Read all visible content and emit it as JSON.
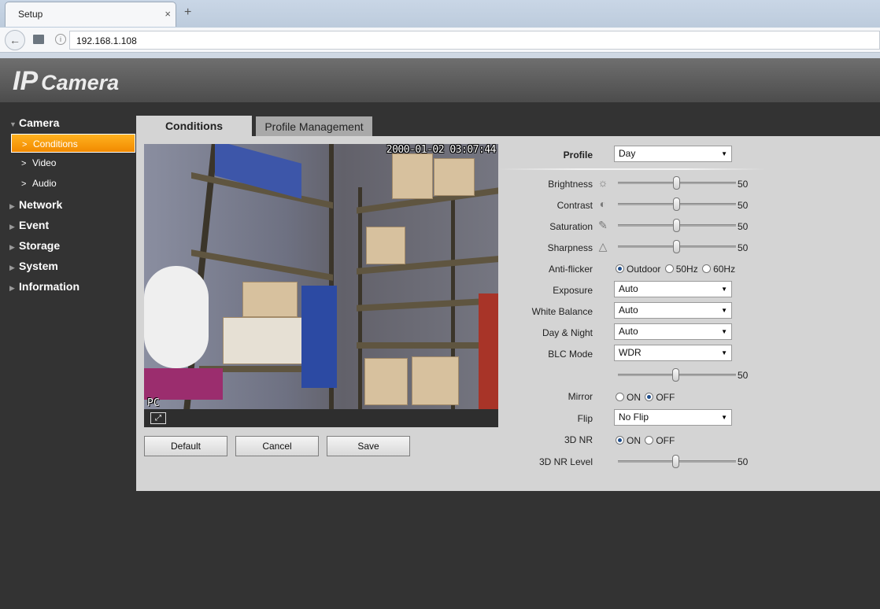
{
  "browser": {
    "tab_title": "Setup",
    "tab_close": "×",
    "new_tab": "+",
    "back": "←",
    "info": "i",
    "address": "192.168.1.108"
  },
  "header": {
    "logo_ip": "IP",
    "logo_camera": "Camera"
  },
  "nav": {
    "items": [
      {
        "label": "Camera",
        "expanded": true,
        "subitems": [
          {
            "label": "Conditions",
            "active": true
          },
          {
            "label": "Video",
            "active": false
          },
          {
            "label": "Audio",
            "active": false
          }
        ]
      },
      {
        "label": "Network"
      },
      {
        "label": "Event"
      },
      {
        "label": "Storage"
      },
      {
        "label": "System"
      },
      {
        "label": "Information"
      }
    ]
  },
  "tabs": [
    {
      "label": "Conditions",
      "active": true
    },
    {
      "label": "Profile Management",
      "active": false
    }
  ],
  "video": {
    "timestamp": "2000-01-02 03:07:44",
    "channel_label": "PC"
  },
  "buttons": {
    "default": "Default",
    "cancel": "Cancel",
    "save": "Save"
  },
  "settings": {
    "profile": {
      "label": "Profile",
      "value": "Day"
    },
    "brightness": {
      "label": "Brightness",
      "value": 50,
      "icon": "sun-icon"
    },
    "contrast": {
      "label": "Contrast",
      "value": 50,
      "icon": "contrast-icon"
    },
    "saturation": {
      "label": "Saturation",
      "value": 50,
      "icon": "saturation-icon"
    },
    "sharpness": {
      "label": "Sharpness",
      "value": 50,
      "icon": "sharpness-icon"
    },
    "anti_flicker": {
      "label": "Anti-flicker",
      "options": [
        "Outdoor",
        "50Hz",
        "60Hz"
      ],
      "selected": "Outdoor"
    },
    "exposure": {
      "label": "Exposure",
      "value": "Auto"
    },
    "white_balance": {
      "label": "White Balance",
      "value": "Auto"
    },
    "day_night": {
      "label": "Day & Night",
      "value": "Auto"
    },
    "blc_mode": {
      "label": "BLC Mode",
      "value": "WDR",
      "level": 50
    },
    "mirror": {
      "label": "Mirror",
      "options": [
        "ON",
        "OFF"
      ],
      "selected": "OFF"
    },
    "flip": {
      "label": "Flip",
      "value": "No Flip"
    },
    "nr3d": {
      "label": "3D NR",
      "options": [
        "ON",
        "OFF"
      ],
      "selected": "ON"
    },
    "nr3d_level": {
      "label": "3D NR Level",
      "value": 50
    }
  },
  "colors": {
    "accent": "#f28a00",
    "panel": "#d4d4d4",
    "background": "#333333"
  }
}
